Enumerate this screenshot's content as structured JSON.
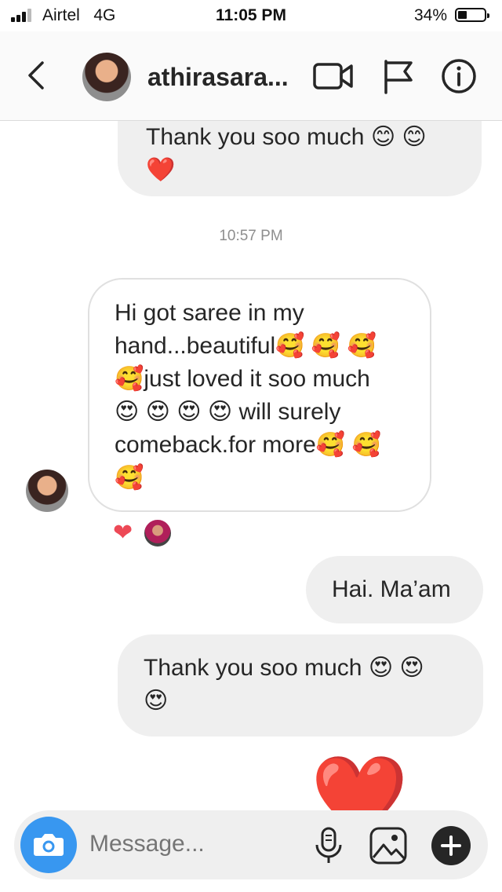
{
  "status_bar": {
    "carrier": "Airtel",
    "network": "4G",
    "time": "11:05 PM",
    "battery": "34%"
  },
  "header": {
    "username": "athirasara..."
  },
  "messages": {
    "partial_out": {
      "text": "Thank you soo much 😊 😊",
      "emoji_line": "❤️"
    },
    "timestamp": "10:57 PM",
    "incoming": {
      "line1": "Hi got saree in my",
      "line2": "hand...beautiful🥰 🥰 🥰",
      "line3": "🥰just loved it soo much",
      "line4": "😍 😍 😍 😍 will surely",
      "line5": "comeback.for more🥰 🥰",
      "line6": "🥰",
      "reaction": "❤"
    },
    "out1": {
      "text": "Hai. Ma’am"
    },
    "out2": {
      "text": "Thank you soo much 😍 😍",
      "emoji_line": "😍"
    },
    "big_hearts": "❤️❤️"
  },
  "composer": {
    "placeholder": "Message..."
  },
  "icons": [
    "back-chevron-icon",
    "video-call-icon",
    "flag-icon",
    "info-icon",
    "camera-icon",
    "microphone-icon",
    "gallery-icon",
    "plus-icon"
  ],
  "colors": {
    "accent": "#3897f0",
    "bubble_gray": "#efefef",
    "heart_red": "#ed4956"
  }
}
